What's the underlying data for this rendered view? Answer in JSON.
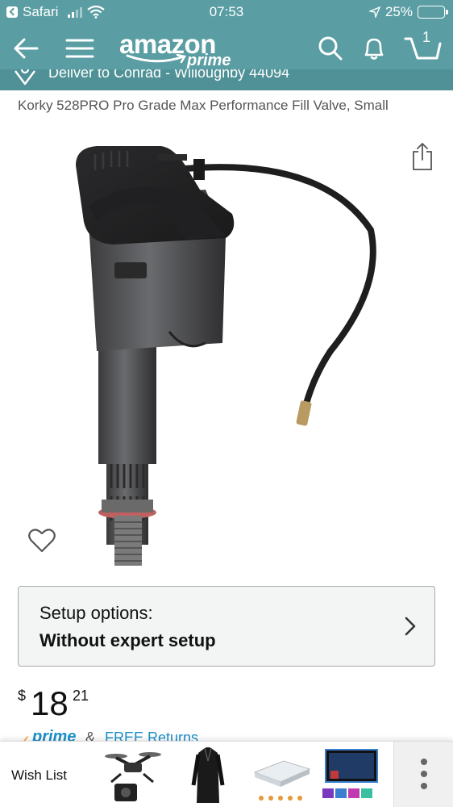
{
  "status_bar": {
    "carrier": "Safari",
    "time": "07:53",
    "battery": "25%",
    "battery_level": 0.25
  },
  "nav": {
    "logo_word": "amazon",
    "logo_prime": "prime",
    "cart_count": "1"
  },
  "deliver": {
    "text": "Deliver to Conrad - Willoughby 44094"
  },
  "product": {
    "title": "Korky 528PRO Pro Grade Max Performance Fill Valve, Small"
  },
  "setup": {
    "label": "Setup options:",
    "value": "Without expert setup"
  },
  "price": {
    "symbol": "$",
    "whole": "18",
    "fraction": "21"
  },
  "prime_row": {
    "check": "✓",
    "prime": "prime",
    "amp": "&",
    "returns": "FREE Returns"
  },
  "bottom_bar": {
    "wish_list": "Wish List"
  },
  "colors": {
    "header": "#5a9ea3",
    "deliver_bar": "#4f9196",
    "link": "#1d8fc7",
    "prime_check": "#f3a847"
  },
  "icons": [
    "back-arrow-icon",
    "menu-icon",
    "search-icon",
    "bell-icon",
    "cart-icon",
    "location-pin-icon",
    "share-icon",
    "heart-icon",
    "chevron-right-icon",
    "more-dots-icon"
  ]
}
